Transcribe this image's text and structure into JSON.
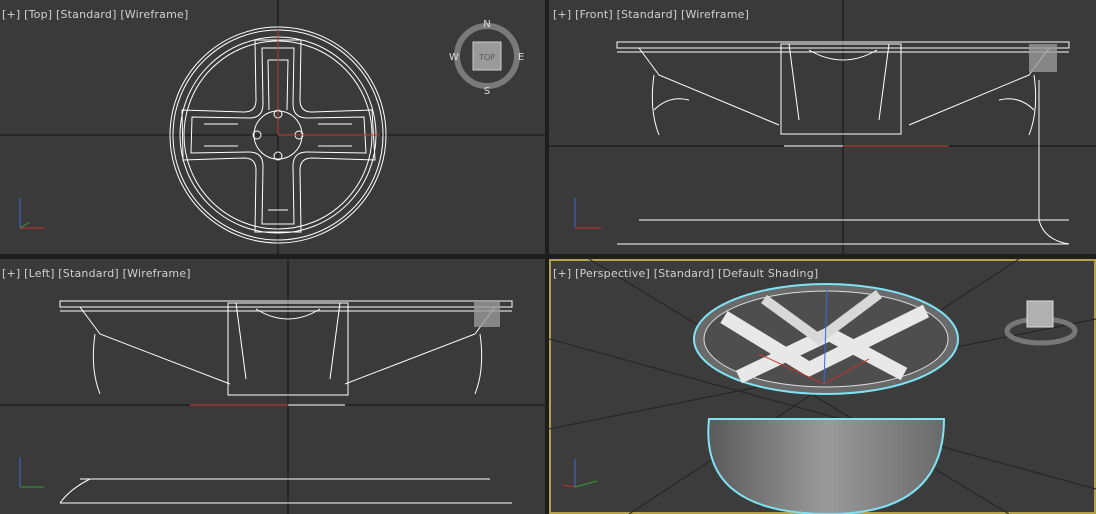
{
  "viewports": {
    "top": {
      "plus": "[+]",
      "view": "[Top]",
      "style": "[Standard]",
      "shading": "[Wireframe]"
    },
    "front": {
      "plus": "[+]",
      "view": "[Front]",
      "style": "[Standard]",
      "shading": "[Wireframe]"
    },
    "left": {
      "plus": "[+]",
      "view": "[Left]",
      "style": "[Standard]",
      "shading": "[Wireframe]"
    },
    "perspective": {
      "plus": "[+]",
      "view": "[Perspective]",
      "style": "[Standard]",
      "shading": "[Default Shading]"
    }
  },
  "compass": {
    "n": "N",
    "s": "S",
    "e": "E",
    "w": "W",
    "cube_label": "TOP"
  },
  "axes": {
    "x": "x",
    "y": "y",
    "z": "z"
  },
  "colors": {
    "viewport_bg": "#3a3a3a",
    "wire": "#ffffff",
    "x_axis": "#c83232",
    "active_border": "#b5a14a",
    "selection": "#7fe3f5"
  }
}
